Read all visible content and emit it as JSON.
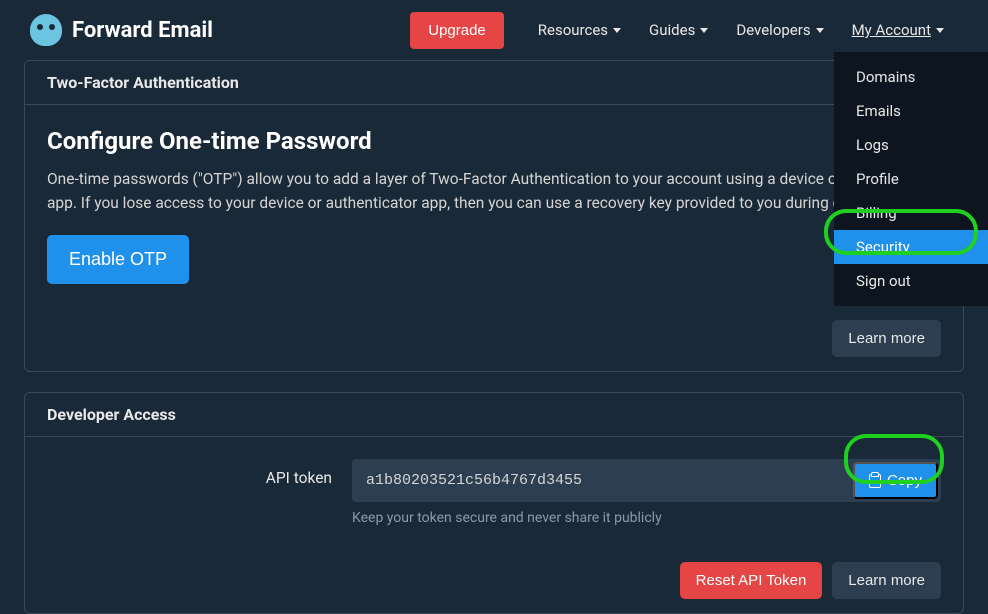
{
  "nav": {
    "brand": "Forward Email",
    "upgrade": "Upgrade",
    "items": [
      "Resources",
      "Guides",
      "Developers",
      "My Account"
    ]
  },
  "dropdown": {
    "items": [
      "Domains",
      "Emails",
      "Logs",
      "Profile",
      "Billing",
      "Security",
      "Sign out"
    ],
    "activeIndex": 5
  },
  "twofa": {
    "header": "Two-Factor Authentication",
    "title": "Configure One-time Password",
    "description": "One-time passwords (\"OTP\") allow you to add a layer of Two-Factor Authentication to your account using a device or authenticator app. If you lose access to your device or authenticator app, then you can use a recovery key provided to you during configuration.",
    "enableBtn": "Enable OTP",
    "learnMore": "Learn more"
  },
  "dev": {
    "header": "Developer Access",
    "label": "API token",
    "token": "a1b80203521c56b4767d3455",
    "copyBtn": "Copy",
    "help": "Keep your token secure and never share it publicly",
    "resetBtn": "Reset API Token",
    "learnMore": "Learn more"
  }
}
